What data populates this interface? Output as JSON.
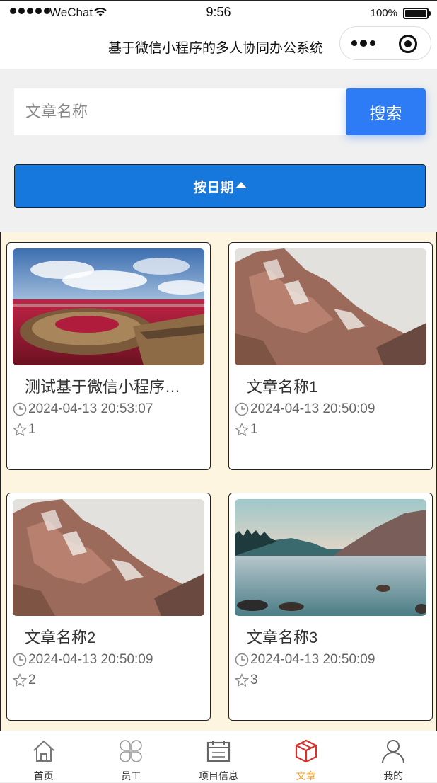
{
  "status_bar": {
    "carrier": "WeChat",
    "time": "9:56",
    "battery": "100%"
  },
  "nav": {
    "title": "基于微信小程序的多人协同办公系统"
  },
  "search": {
    "placeholder": "文章名称",
    "button_label": "搜索"
  },
  "sort": {
    "label": "按日期"
  },
  "articles": [
    {
      "title": "测试基于微信小程序的多人协同办公系统",
      "date": "2024-04-13 20:53:07",
      "favorites": "1",
      "image": "red-beach-boardwalk"
    },
    {
      "title": "文章名称1",
      "date": "2024-04-13 20:50:09",
      "favorites": "1",
      "image": "rocky-mountain"
    },
    {
      "title": "文章名称2",
      "date": "2024-04-13 20:50:09",
      "favorites": "2",
      "image": "rocky-mountain"
    },
    {
      "title": "文章名称3",
      "date": "2024-04-13 20:50:09",
      "favorites": "3",
      "image": "mountain-lake"
    }
  ],
  "tabbar": {
    "items": [
      {
        "label": "首页",
        "icon": "home-icon"
      },
      {
        "label": "员工",
        "icon": "grid-icon"
      },
      {
        "label": "项目信息",
        "icon": "calendar-icon"
      },
      {
        "label": "文章",
        "icon": "cube-icon"
      },
      {
        "label": "我的",
        "icon": "user-icon"
      }
    ],
    "active_color": "#f0a020"
  },
  "colors": {
    "search_button": "#2d7cf6",
    "sort_button": "#1677dc",
    "list_background": "#fdf5e0"
  }
}
